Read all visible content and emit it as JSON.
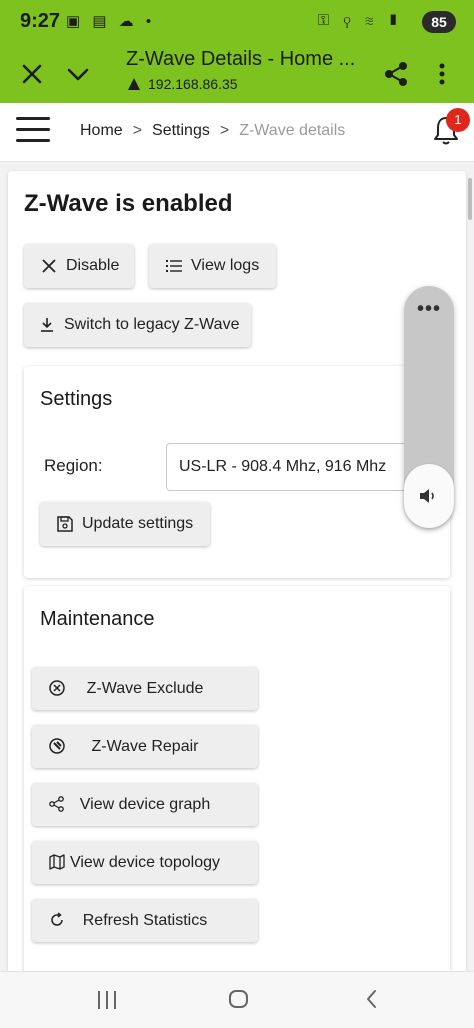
{
  "status_bar": {
    "time": "9:27",
    "battery": "85"
  },
  "browser": {
    "title": "Z-Wave Details - Home ...",
    "url": "192.168.86.35"
  },
  "breadcrumb": {
    "home": "Home",
    "settings": "Settings",
    "current": "Z-Wave details"
  },
  "notifications": {
    "count": "1"
  },
  "page": {
    "heading": "Z-Wave is enabled",
    "disable_label": "Disable",
    "view_logs_label": "View logs",
    "legacy_label": "Switch to legacy Z-Wave"
  },
  "settings": {
    "title": "Settings",
    "region_label": "Region:",
    "region_value": "US-LR - 908.4 Mhz, 916 Mhz",
    "update_label": "Update settings"
  },
  "maintenance": {
    "title": "Maintenance",
    "buttons": [
      {
        "label": "Z-Wave Exclude",
        "icon": "x-circle-icon"
      },
      {
        "label": "Z-Wave Repair",
        "icon": "repair-icon"
      },
      {
        "label": "View device graph",
        "icon": "share-graph-icon"
      },
      {
        "label": "View device topology",
        "icon": "map-icon"
      },
      {
        "label": "Refresh Statistics",
        "icon": "refresh-icon"
      }
    ]
  },
  "colors": {
    "chrome": "#7dc21e",
    "badge": "#e0271e"
  }
}
